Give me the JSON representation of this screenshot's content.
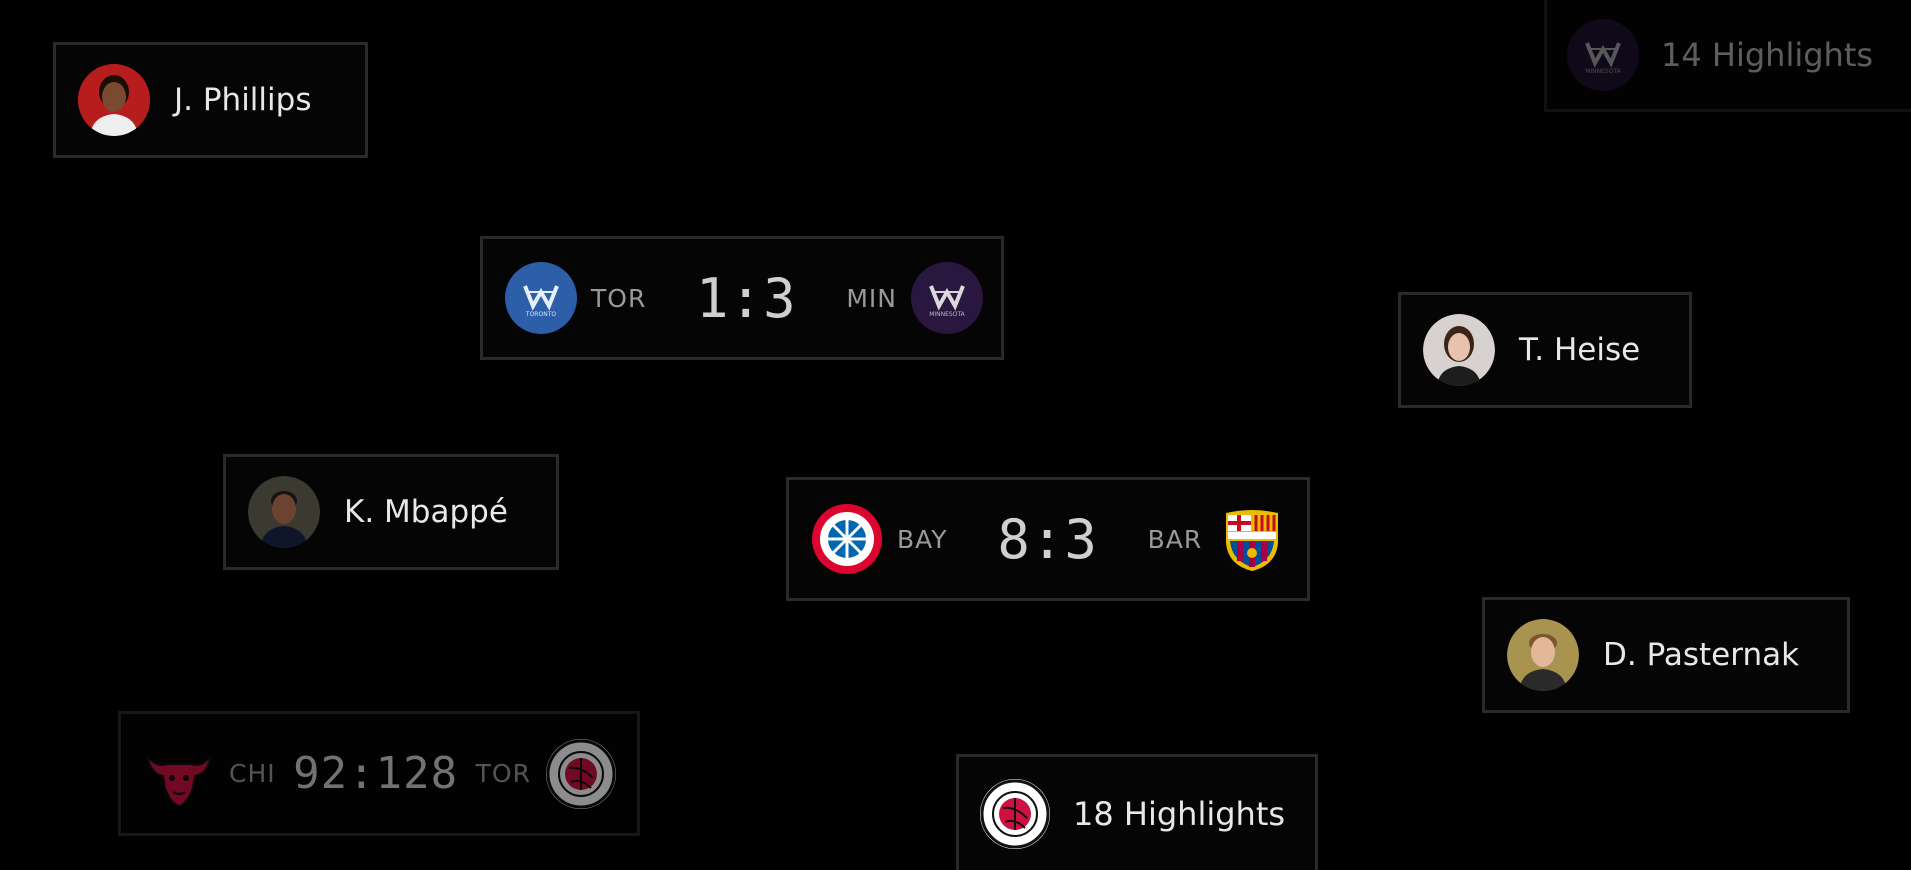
{
  "players": [
    {
      "name": "J. Phillips",
      "avatar_bg": "#b81d1d"
    },
    {
      "name": "T. Heise",
      "avatar_bg": "#d7d2cf"
    },
    {
      "name": "K. Mbappé",
      "avatar_bg": "#3b3a30"
    },
    {
      "name": "D. Pasternak",
      "avatar_bg": "#a8944e"
    }
  ],
  "matches": [
    {
      "home": {
        "abbr": "TOR",
        "logo": "toronto-pwhl-logo",
        "logo_text": "TORONTO",
        "color": "#2d5fa8"
      },
      "away": {
        "abbr": "MIN",
        "logo": "minnesota-pwhl-logo",
        "logo_text": "MINNESOTA",
        "color": "#2a1740"
      },
      "score": "1:3"
    },
    {
      "home": {
        "abbr": "BAY",
        "logo": "fc-bayern-logo",
        "color": "#dc052d"
      },
      "away": {
        "abbr": "BAR",
        "logo": "fc-barcelona-logo",
        "color": "#a50044"
      },
      "score": "8:3"
    },
    {
      "home": {
        "abbr": "CHI",
        "logo": "chicago-bulls-logo",
        "color": "#ce1141"
      },
      "away": {
        "abbr": "TOR",
        "logo": "toronto-raptors-logo",
        "color": "#ce1141"
      },
      "score": "92:128"
    }
  ],
  "highlights": [
    {
      "label": "14 Highlights",
      "logo": "minnesota-pwhl-logo",
      "logo_text": "MINNESOTA",
      "color": "#2a1740"
    },
    {
      "label": "18 Highlights",
      "logo": "toronto-raptors-logo",
      "color": "#ce1141"
    }
  ]
}
